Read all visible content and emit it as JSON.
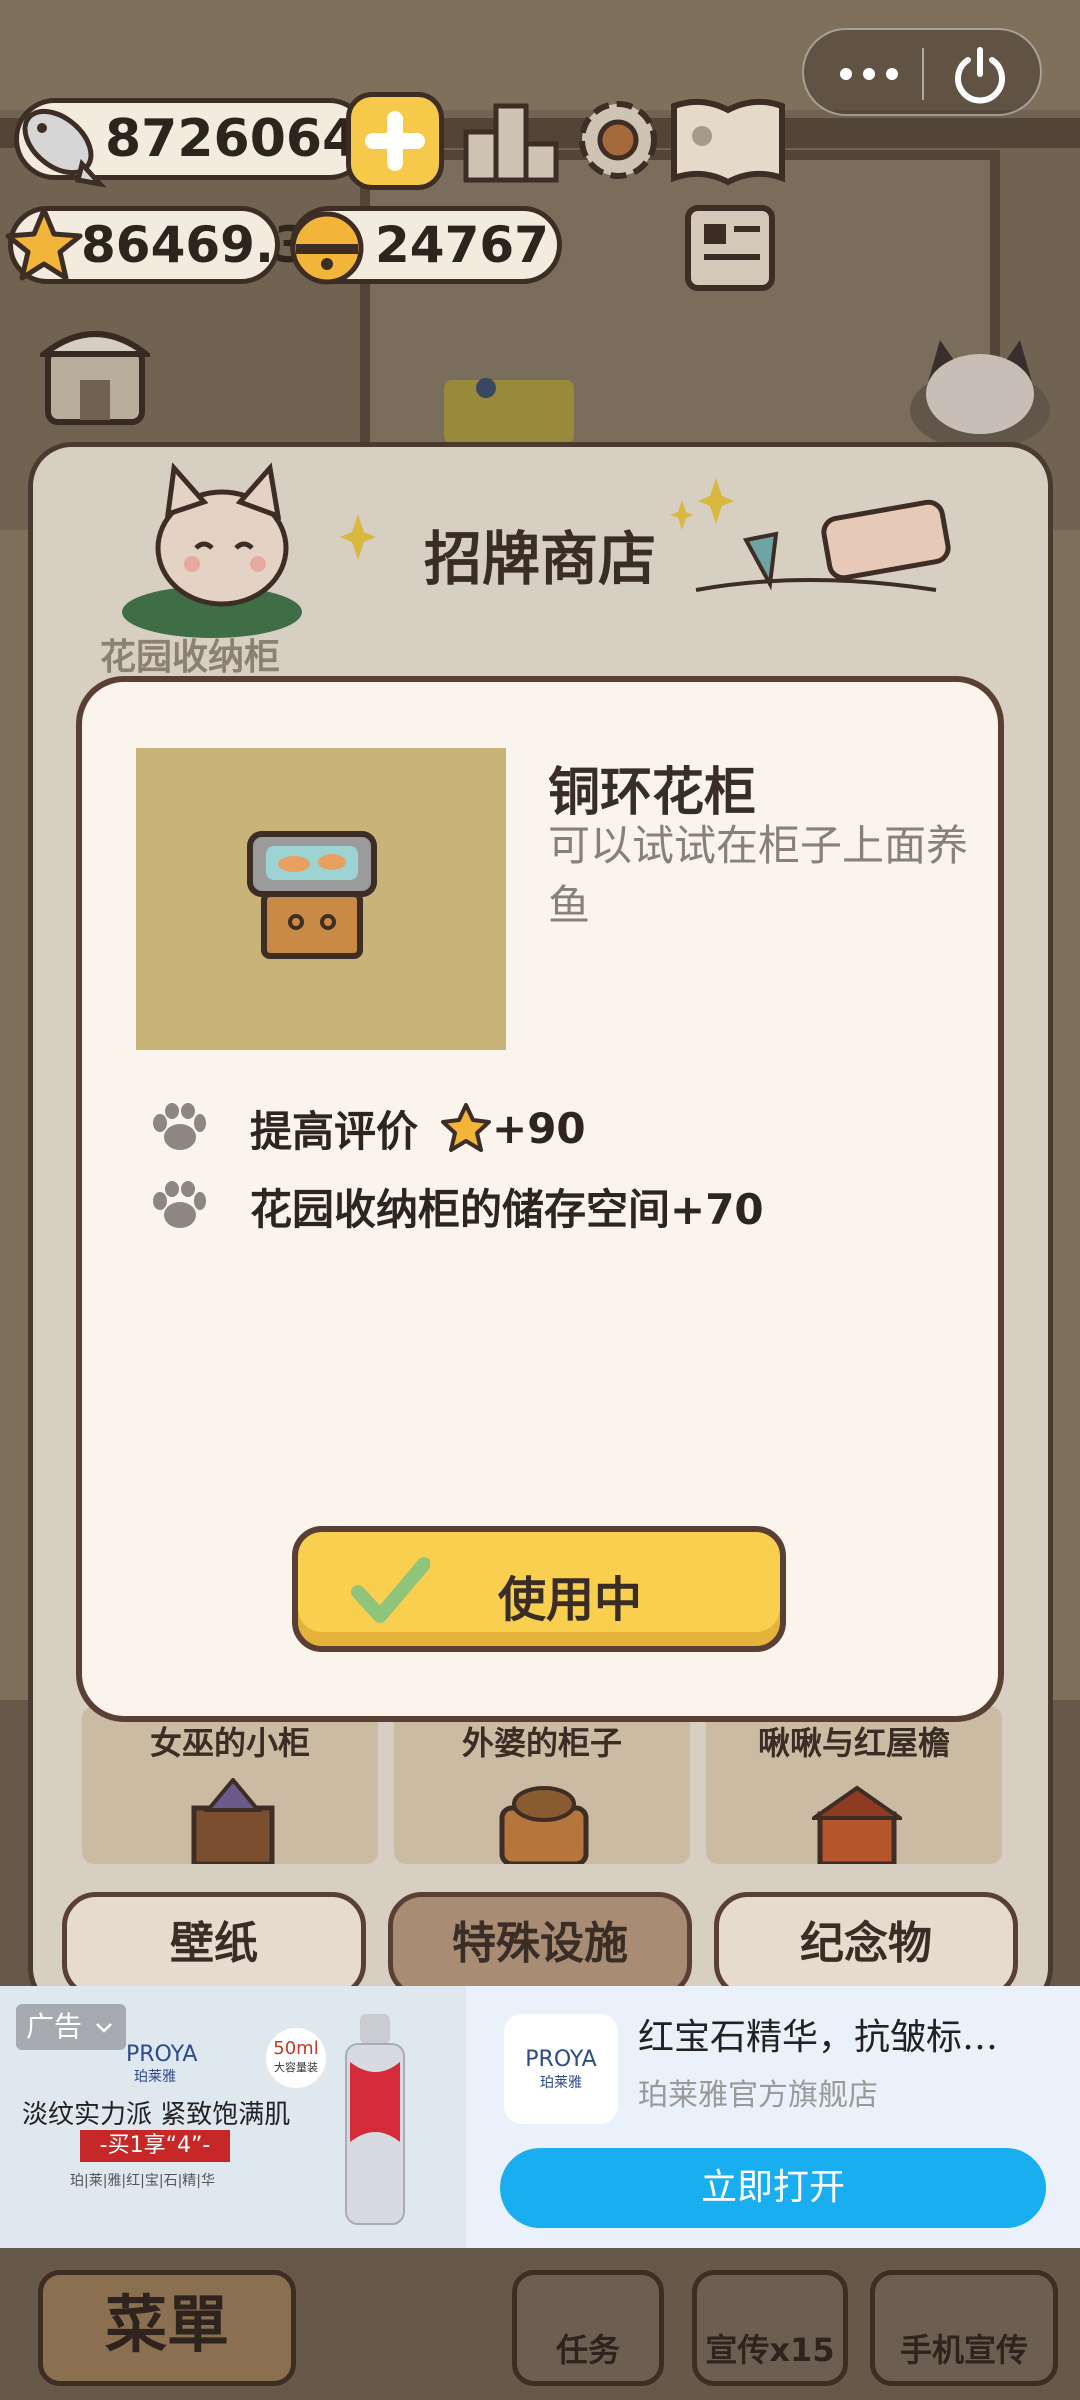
{
  "hud": {
    "fish_count": "8726064",
    "star_count": "86469.3",
    "bell_count": "24767"
  },
  "dialog": {
    "title": "招牌商店",
    "section_label": "花园收纳柜",
    "item": {
      "name": "铜环花柜",
      "description": "可以试试在柜子上面养鱼"
    },
    "effects": [
      {
        "label": "提高评价",
        "value": "+90"
      },
      {
        "label": "花园收纳柜的储存空间+70"
      }
    ],
    "use_button_label": "使用中"
  },
  "shelf_items": [
    {
      "label": "女巫的小柜"
    },
    {
      "label": "外婆的柜子"
    },
    {
      "label": "啾啾与红屋檐"
    }
  ],
  "tabs": [
    "壁纸",
    "特殊设施",
    "纪念物"
  ],
  "bottom_menu": {
    "menu": "菜單",
    "task": "任务",
    "promo": "宣传x15",
    "phone_promo": "手机宣传"
  },
  "ad": {
    "tag": "广告",
    "brand": "PROYA",
    "brand_cn": "珀莱雅",
    "size_badge": "50ml",
    "size_badge_sub": "大容量装",
    "slogan": "淡纹实力派 紧致饱满肌",
    "offer": "-买1享“4”-",
    "product_line": "珀|莱|雅|红|宝|石|精|华",
    "headline": "红宝石精华，抗皱标…",
    "store": "珀莱雅官方旗舰店",
    "open_button": "立即打开"
  },
  "colors": {
    "button_yellow": "#f8cf4f",
    "ad_blue": "#19aef0",
    "card_bg": "#fbf4ec"
  }
}
